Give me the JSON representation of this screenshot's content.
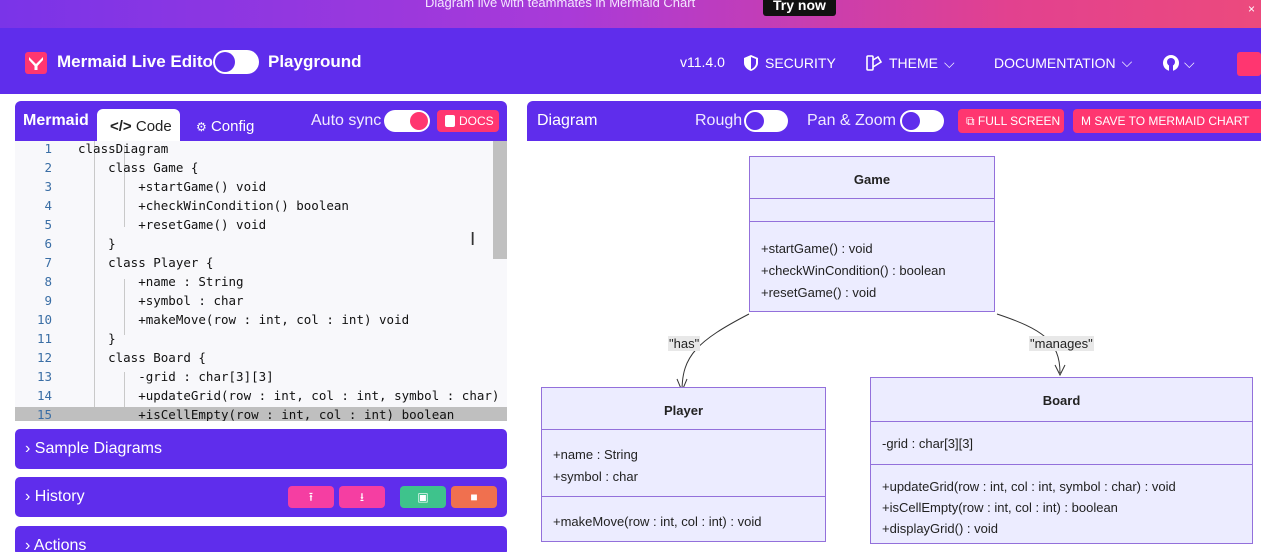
{
  "banner": {
    "message": "Diagram live with teammates in Mermaid Chart",
    "cta": "Try now",
    "close": "×"
  },
  "navbar": {
    "title": "Mermaid Live Editor",
    "playground": "Playground",
    "version": "v11.4.0",
    "security": "SECURITY",
    "theme": "THEME",
    "documentation": "DOCUMENTATION",
    "chevron": "⌵"
  },
  "editor_panel": {
    "label": "Mermaid",
    "tab_code": "Code",
    "tab_config": "Config",
    "auto_sync": "Auto sync",
    "docs": "DOCS",
    "lines": [
      {
        "n": "1",
        "text": "classDiagram"
      },
      {
        "n": "2",
        "text": "    class Game {"
      },
      {
        "n": "3",
        "text": "        +startGame() void"
      },
      {
        "n": "4",
        "text": "        +checkWinCondition() boolean"
      },
      {
        "n": "5",
        "text": "        +resetGame() void"
      },
      {
        "n": "6",
        "text": "    }"
      },
      {
        "n": "7",
        "text": "    class Player {"
      },
      {
        "n": "8",
        "text": "        +name : String"
      },
      {
        "n": "9",
        "text": "        +symbol : char"
      },
      {
        "n": "10",
        "text": "        +makeMove(row : int, col : int) void"
      },
      {
        "n": "11",
        "text": "    }"
      },
      {
        "n": "12",
        "text": "    class Board {"
      },
      {
        "n": "13",
        "text": "        -grid : char[3][3]"
      },
      {
        "n": "14",
        "text": "        +updateGrid(row : int, col : int, symbol : char)"
      },
      {
        "n": "15",
        "text": "        +isCellEmpty(row : int, col : int) boolean"
      }
    ]
  },
  "accordions": {
    "sample": "Sample Diagrams",
    "history": "History",
    "actions": "Actions",
    "chevron": "›"
  },
  "diagram_panel": {
    "label": "Diagram",
    "rough": "Rough",
    "pan_zoom": "Pan & Zoom",
    "full_screen": "FULL SCREEN",
    "save": "SAVE TO MERMAID CHART"
  },
  "diagram": {
    "game": {
      "name": "Game",
      "methods": [
        "+startGame() : void",
        "+checkWinCondition() : boolean",
        "+resetGame() : void"
      ]
    },
    "player": {
      "name": "Player",
      "attributes": [
        "+name : String",
        "+symbol : char"
      ],
      "methods": [
        "+makeMove(row : int, col : int) : void"
      ]
    },
    "board": {
      "name": "Board",
      "attributes": [
        "-grid : char[3][3]"
      ],
      "methods": [
        "+updateGrid(row : int, col : int, symbol : char) : void",
        "+isCellEmpty(row : int, col : int) : boolean",
        "+displayGrid() : void"
      ]
    },
    "edge_has": "\"has\"",
    "edge_manages": "\"manages\""
  },
  "colors": {
    "primary": "#5f2dec",
    "accent": "#ff3670",
    "uml_fill": "#ececff",
    "uml_border": "#9370db"
  }
}
